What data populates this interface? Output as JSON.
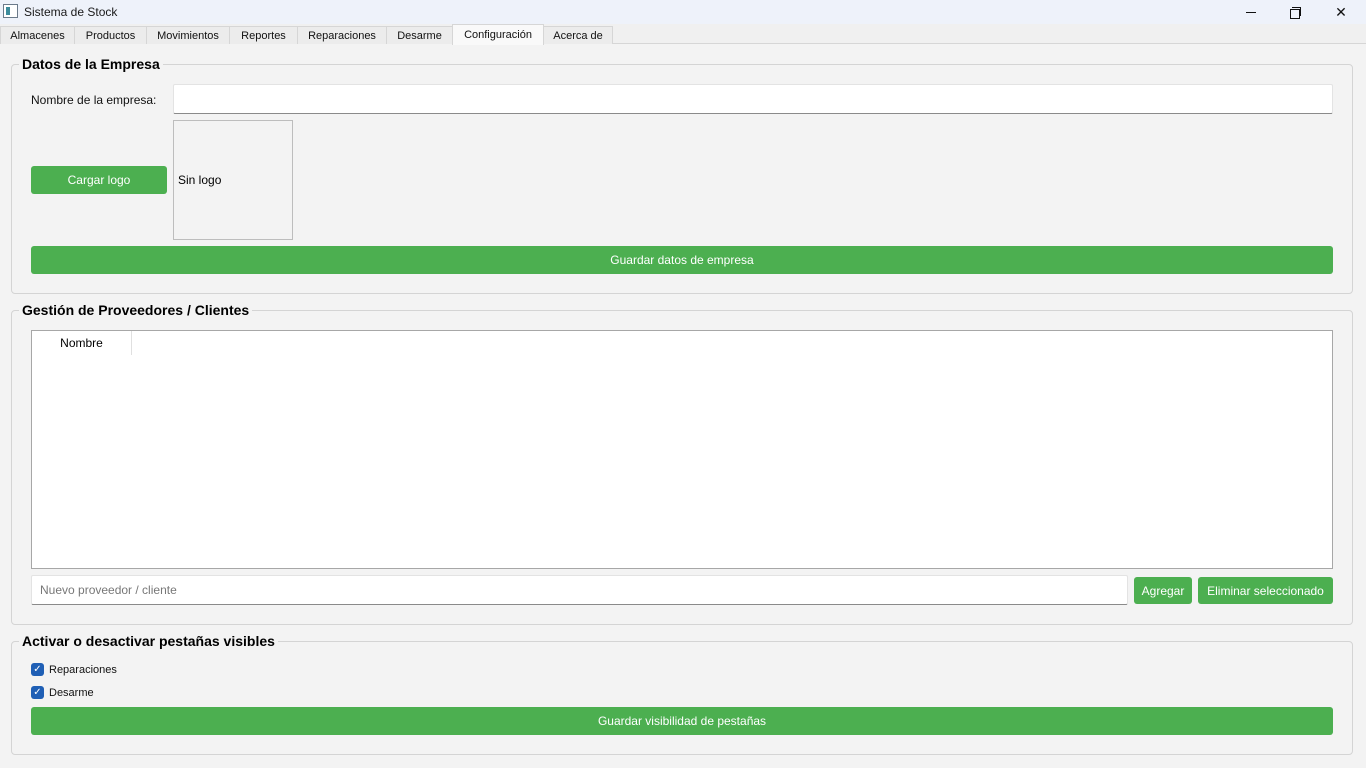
{
  "window": {
    "title": "Sistema de Stock",
    "minimize_glyph": "",
    "close_glyph": "✕"
  },
  "tabs": [
    {
      "label": "Almacenes",
      "active": false
    },
    {
      "label": "Productos",
      "active": false
    },
    {
      "label": "Movimientos",
      "active": false
    },
    {
      "label": "Reportes",
      "active": false
    },
    {
      "label": "Reparaciones",
      "active": false
    },
    {
      "label": "Desarme",
      "active": false
    },
    {
      "label": "Configuración",
      "active": true
    },
    {
      "label": "Acerca de",
      "active": false
    }
  ],
  "company": {
    "title": "Datos de la Empresa",
    "name_label": "Nombre de la empresa:",
    "name_value": "",
    "load_logo_label": "Cargar logo",
    "logo_placeholder": "Sin logo",
    "save_label": "Guardar datos de empresa"
  },
  "providers": {
    "title": "Gestión de Proveedores / Clientes",
    "column_header": "Nombre",
    "rows": [],
    "new_placeholder": "Nuevo proveedor / cliente",
    "add_label": "Agregar",
    "delete_label": "Eliminar seleccionado"
  },
  "visibility": {
    "title": "Activar o desactivar pestañas visibles",
    "options": [
      {
        "label": "Reparaciones",
        "checked": true
      },
      {
        "label": "Desarme",
        "checked": true
      }
    ],
    "save_label": "Guardar visibilidad de pestañas"
  },
  "colors": {
    "accent_green": "#4caf50",
    "checkbox_blue": "#1f5fb5"
  }
}
